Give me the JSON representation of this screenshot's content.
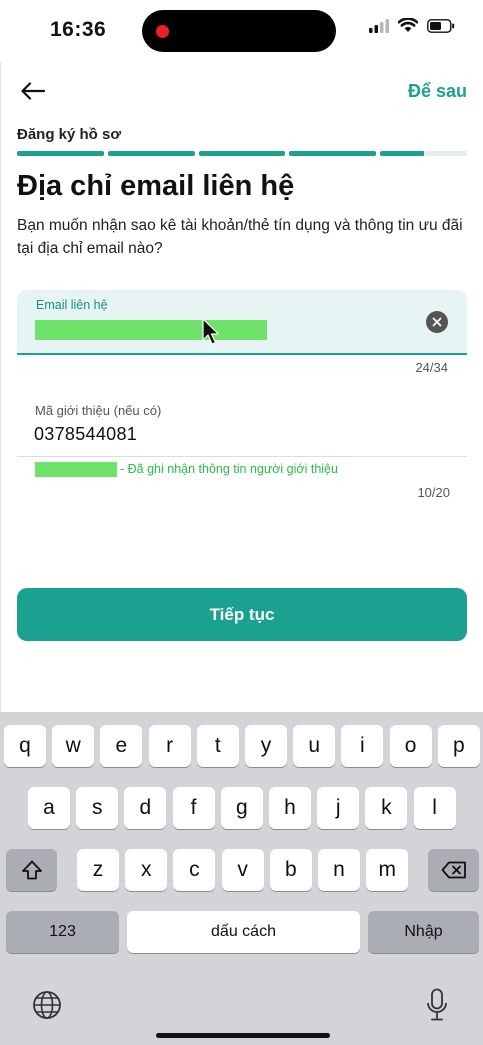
{
  "status_bar": {
    "time": "16:36"
  },
  "header": {
    "back_icon": "arrow-left-icon",
    "later_label": "Để sau"
  },
  "step": {
    "label": "Đăng ký hồ sơ",
    "progress_fraction": 0.9
  },
  "page": {
    "title": "Địa chỉ email liên hệ",
    "description": "Bạn muốn nhận sao kê tài khoản/thẻ tín dụng và thông tin ưu đãi tại địa chỉ email nào?"
  },
  "email_field": {
    "label": "Email liên hệ",
    "char_count": "24/34"
  },
  "referral_field": {
    "label": "Mã giới thiệu (nếu có)",
    "value": "0378544081",
    "note": "- Đã ghi nhận thông tin người giới thiệu",
    "char_count": "10/20"
  },
  "continue_button": {
    "label": "Tiếp tục"
  },
  "keyboard": {
    "row1": [
      "q",
      "w",
      "e",
      "r",
      "t",
      "y",
      "u",
      "i",
      "o",
      "p"
    ],
    "row2": [
      "a",
      "s",
      "d",
      "f",
      "g",
      "h",
      "j",
      "k",
      "l"
    ],
    "row3": [
      "z",
      "x",
      "c",
      "v",
      "b",
      "n",
      "m"
    ],
    "numbers_label": "123",
    "space_label": "dấu cách",
    "return_label": "Nhập"
  },
  "colors": {
    "accent": "#1ba18f",
    "success": "#2dbb45",
    "redaction": "#6ee26a"
  }
}
